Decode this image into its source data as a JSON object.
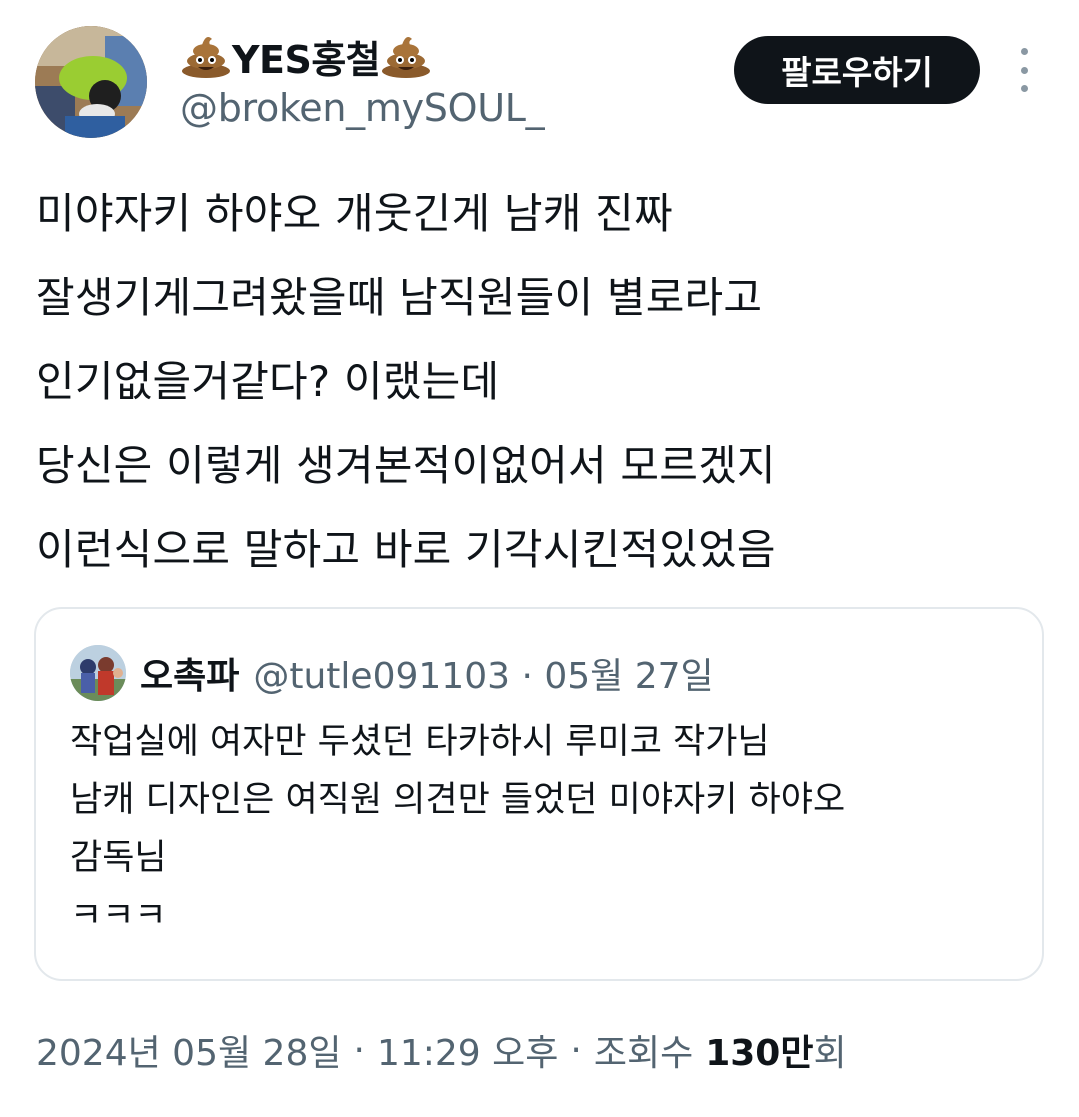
{
  "author": {
    "display_name": "YES홍철",
    "handle": "@broken_mySOUL_",
    "name_emoji": "pile-of-poo-icon"
  },
  "actions": {
    "follow_label": "팔로우하기",
    "more_icon": "more-options-icon"
  },
  "tweet": {
    "lines": [
      "미야자키 하야오 개웃긴게 남캐 진짜",
      "잘생기게그려왔을때 남직원들이 별로라고",
      "인기없을거같다? 이랬는데",
      "당신은 이렇게 생겨본적이없어서 모르겠지",
      "이런식으로 말하고 바로 기각시킨적있었음"
    ]
  },
  "quote": {
    "display_name": "오촉파",
    "meta": "@tutle091103 · 05월 27일",
    "lines": [
      "작업실에 여자만 두셨던 타카하시 루미코 작가님",
      "남캐 디자인은 여직원 의견만 들었던 미야자키 하야오",
      "감독님",
      "ㅋㅋㅋ"
    ]
  },
  "footer": {
    "date": "2024년 05월 28일",
    "time": "11:29 오후",
    "views_label": "조회수",
    "views_number": "130만",
    "views_suffix": "회",
    "separator": "·"
  }
}
